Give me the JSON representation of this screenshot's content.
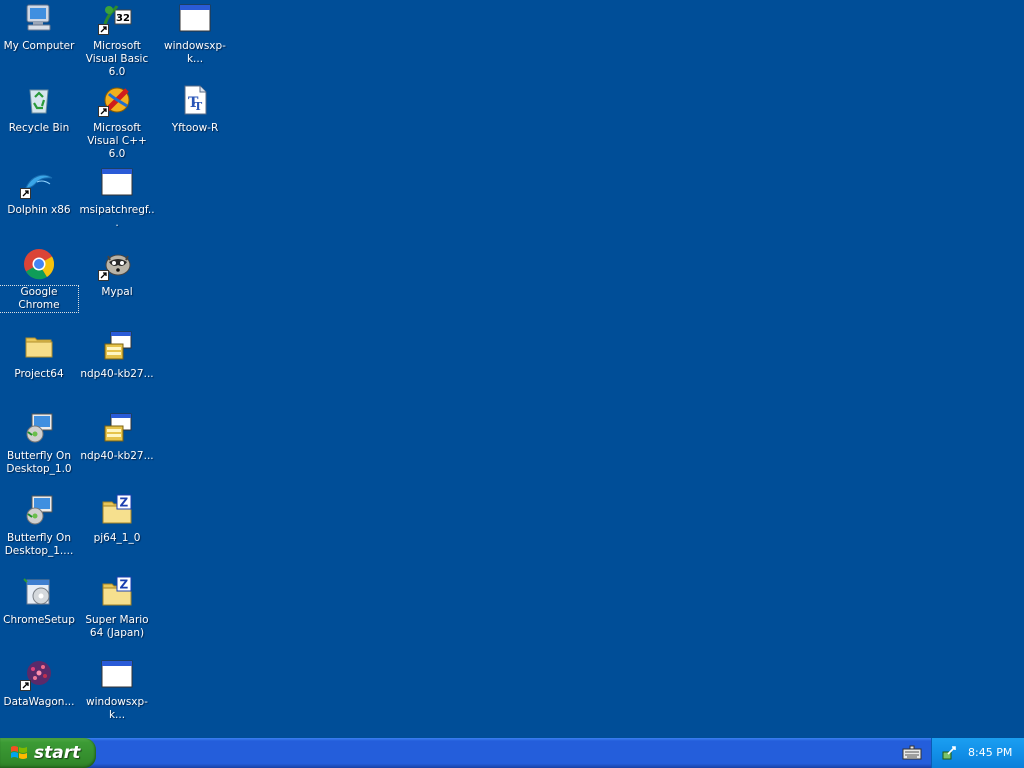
{
  "desktop": {
    "icons": [
      {
        "label": "My Computer"
      },
      {
        "label": "Microsoft Visual Basic 6.0"
      },
      {
        "label": "windowsxp-k..."
      },
      {
        "label": "Recycle Bin"
      },
      {
        "label": "Microsoft Visual C++ 6.0"
      },
      {
        "label": "Yftoow-R"
      },
      {
        "label": "Dolphin x86"
      },
      {
        "label": "msipatchregf..."
      },
      {
        "label": "Google Chrome"
      },
      {
        "label": "Mypal"
      },
      {
        "label": "Project64"
      },
      {
        "label": "ndp40-kb27..."
      },
      {
        "label": "Butterfly On Desktop_1.0"
      },
      {
        "label": "ndp40-kb27..."
      },
      {
        "label": "Butterfly On Desktop_1...."
      },
      {
        "label": "pj64_1_0"
      },
      {
        "label": "ChromeSetup"
      },
      {
        "label": "Super Mario 64 (Japan)"
      },
      {
        "label": "DataWagon..."
      },
      {
        "label": "windowsxp-k..."
      }
    ]
  },
  "taskbar": {
    "start_label": "start",
    "clock": "8:45 PM"
  },
  "colors": {
    "desktop_bg": "#004e98",
    "taskbar_blue": "#245edb",
    "start_green": "#3c9b35",
    "tray_blue": "#1290e8"
  }
}
